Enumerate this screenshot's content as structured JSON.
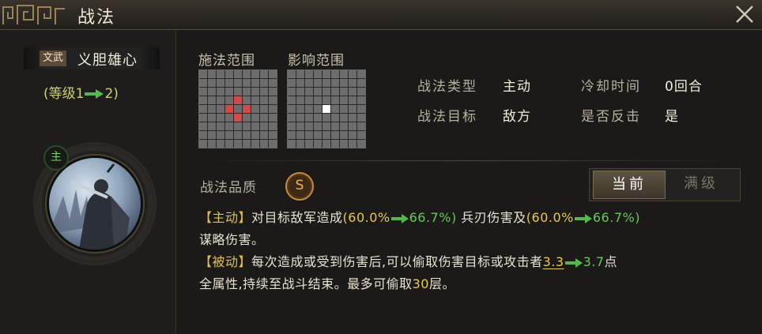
{
  "window": {
    "title": "战法"
  },
  "skill": {
    "type_tag": "文武",
    "name": "义胆雄心",
    "level_prefix": "(等级1",
    "level_suffix": "2)",
    "main_tag": "主"
  },
  "ranges": {
    "cast_label": "施法范围",
    "effect_label": "影响范围"
  },
  "info": {
    "type_label": "战法类型",
    "type_value": "主动",
    "target_label": "战法目标",
    "target_value": "敌方",
    "cooldown_label": "冷却时间",
    "cooldown_value": "0回合",
    "counter_label": "是否反击",
    "counter_value": "是"
  },
  "quality": {
    "label": "战法品质",
    "grade": "S"
  },
  "toggle": {
    "current": "当前",
    "max": "满级"
  },
  "desc": {
    "active_tag": "【主动】",
    "active_text_1": "对目标敌军造成",
    "p1_open": "(60.0%",
    "p1_close": "66.7%)",
    "active_text_2": "兵刃伤害及",
    "p2_open": "(60.0%",
    "p2_close": "66.7%)",
    "active_text_3": "谋略伤害。",
    "passive_tag": "【被动】",
    "passive_text_1": "每次造成或受到伤害后,可以偷取伤害目标或攻击者",
    "steal_from": "3.3",
    "steal_to": "3.7",
    "passive_unit": "点",
    "passive_text_2": "全属性,持续至战斗结束。最多可偷取",
    "max_layers": "30",
    "passive_text_3": "层。"
  },
  "colors": {
    "highlight": "#e2c04a",
    "green": "#66c85a",
    "red_cell": "#d24a48"
  },
  "icons": {
    "close": "close-icon",
    "arrow": "green-arrow-icon"
  }
}
